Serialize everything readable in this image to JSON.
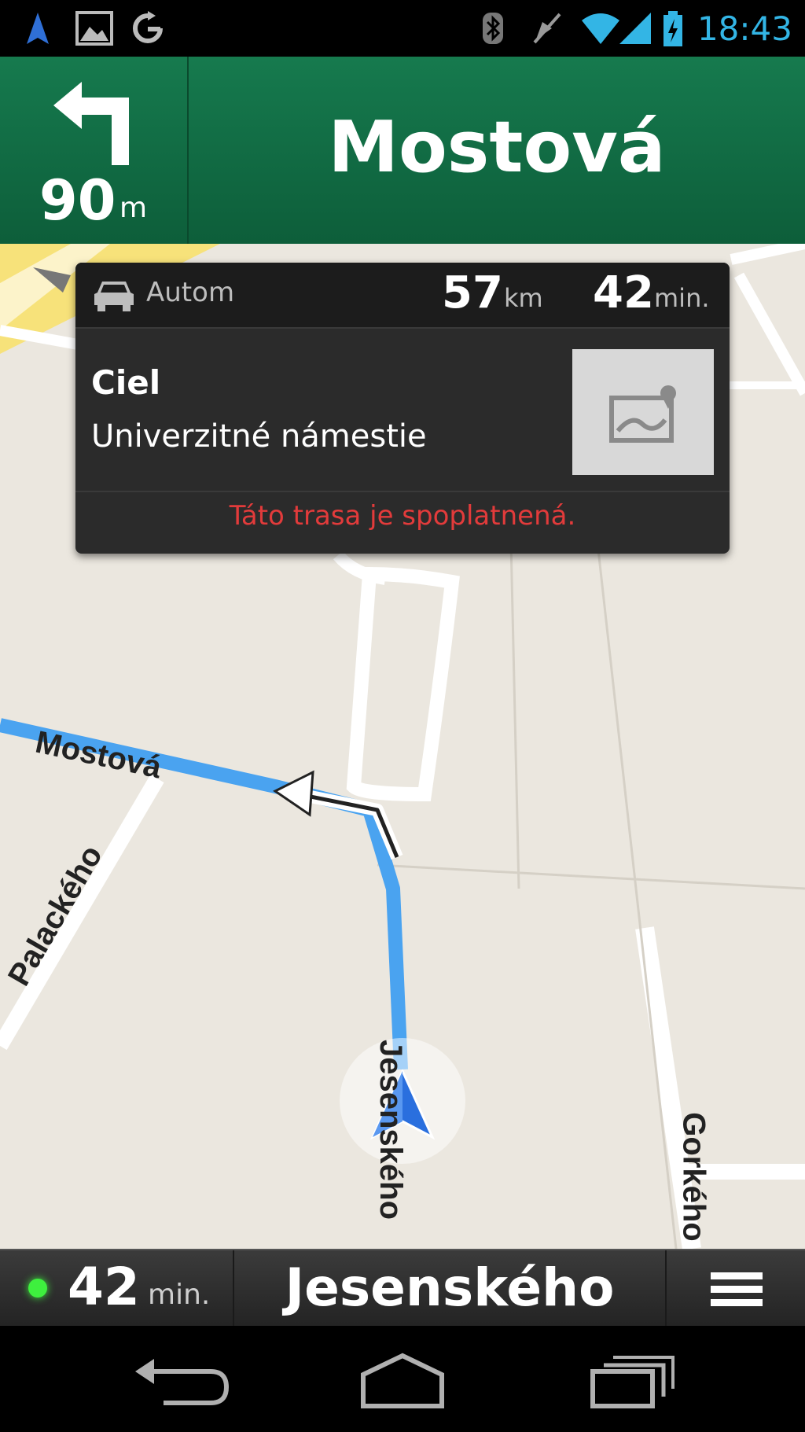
{
  "status_bar": {
    "time": "18:43",
    "icons": [
      "navigation-icon",
      "picture-icon",
      "sync-icon",
      "bluetooth-icon",
      "mute-icon",
      "wifi-icon",
      "signal-icon",
      "battery-icon"
    ]
  },
  "nav_header": {
    "turn_direction": "turn-left-icon",
    "distance_value": "90",
    "distance_unit": "m",
    "street": "Mostová"
  },
  "route_card": {
    "mode_label": "Autom",
    "distance_value": "57",
    "distance_unit": "km",
    "time_value": "42",
    "time_unit": "min.",
    "destination_title": "Ciel",
    "destination_address": "Univerzitné námestie",
    "toll_warning": "Táto trasa je spoplatnená."
  },
  "map": {
    "labels": {
      "mostova": "Mostová",
      "palackeho": "Palackého",
      "jesenskeho": "Jesenského",
      "gorkeho": "Gorkého"
    },
    "colors": {
      "route": "#4aa3f0",
      "background": "#ebe7df",
      "road": "#ffffff"
    }
  },
  "bottom_bar": {
    "eta_value": "42",
    "eta_unit": "min.",
    "current_street": "Jesenského"
  },
  "colors": {
    "header_green": "#167a4e",
    "status_blue": "#33b5e5",
    "warning_red": "#e23b3b",
    "eta_green": "#3ef03e"
  }
}
